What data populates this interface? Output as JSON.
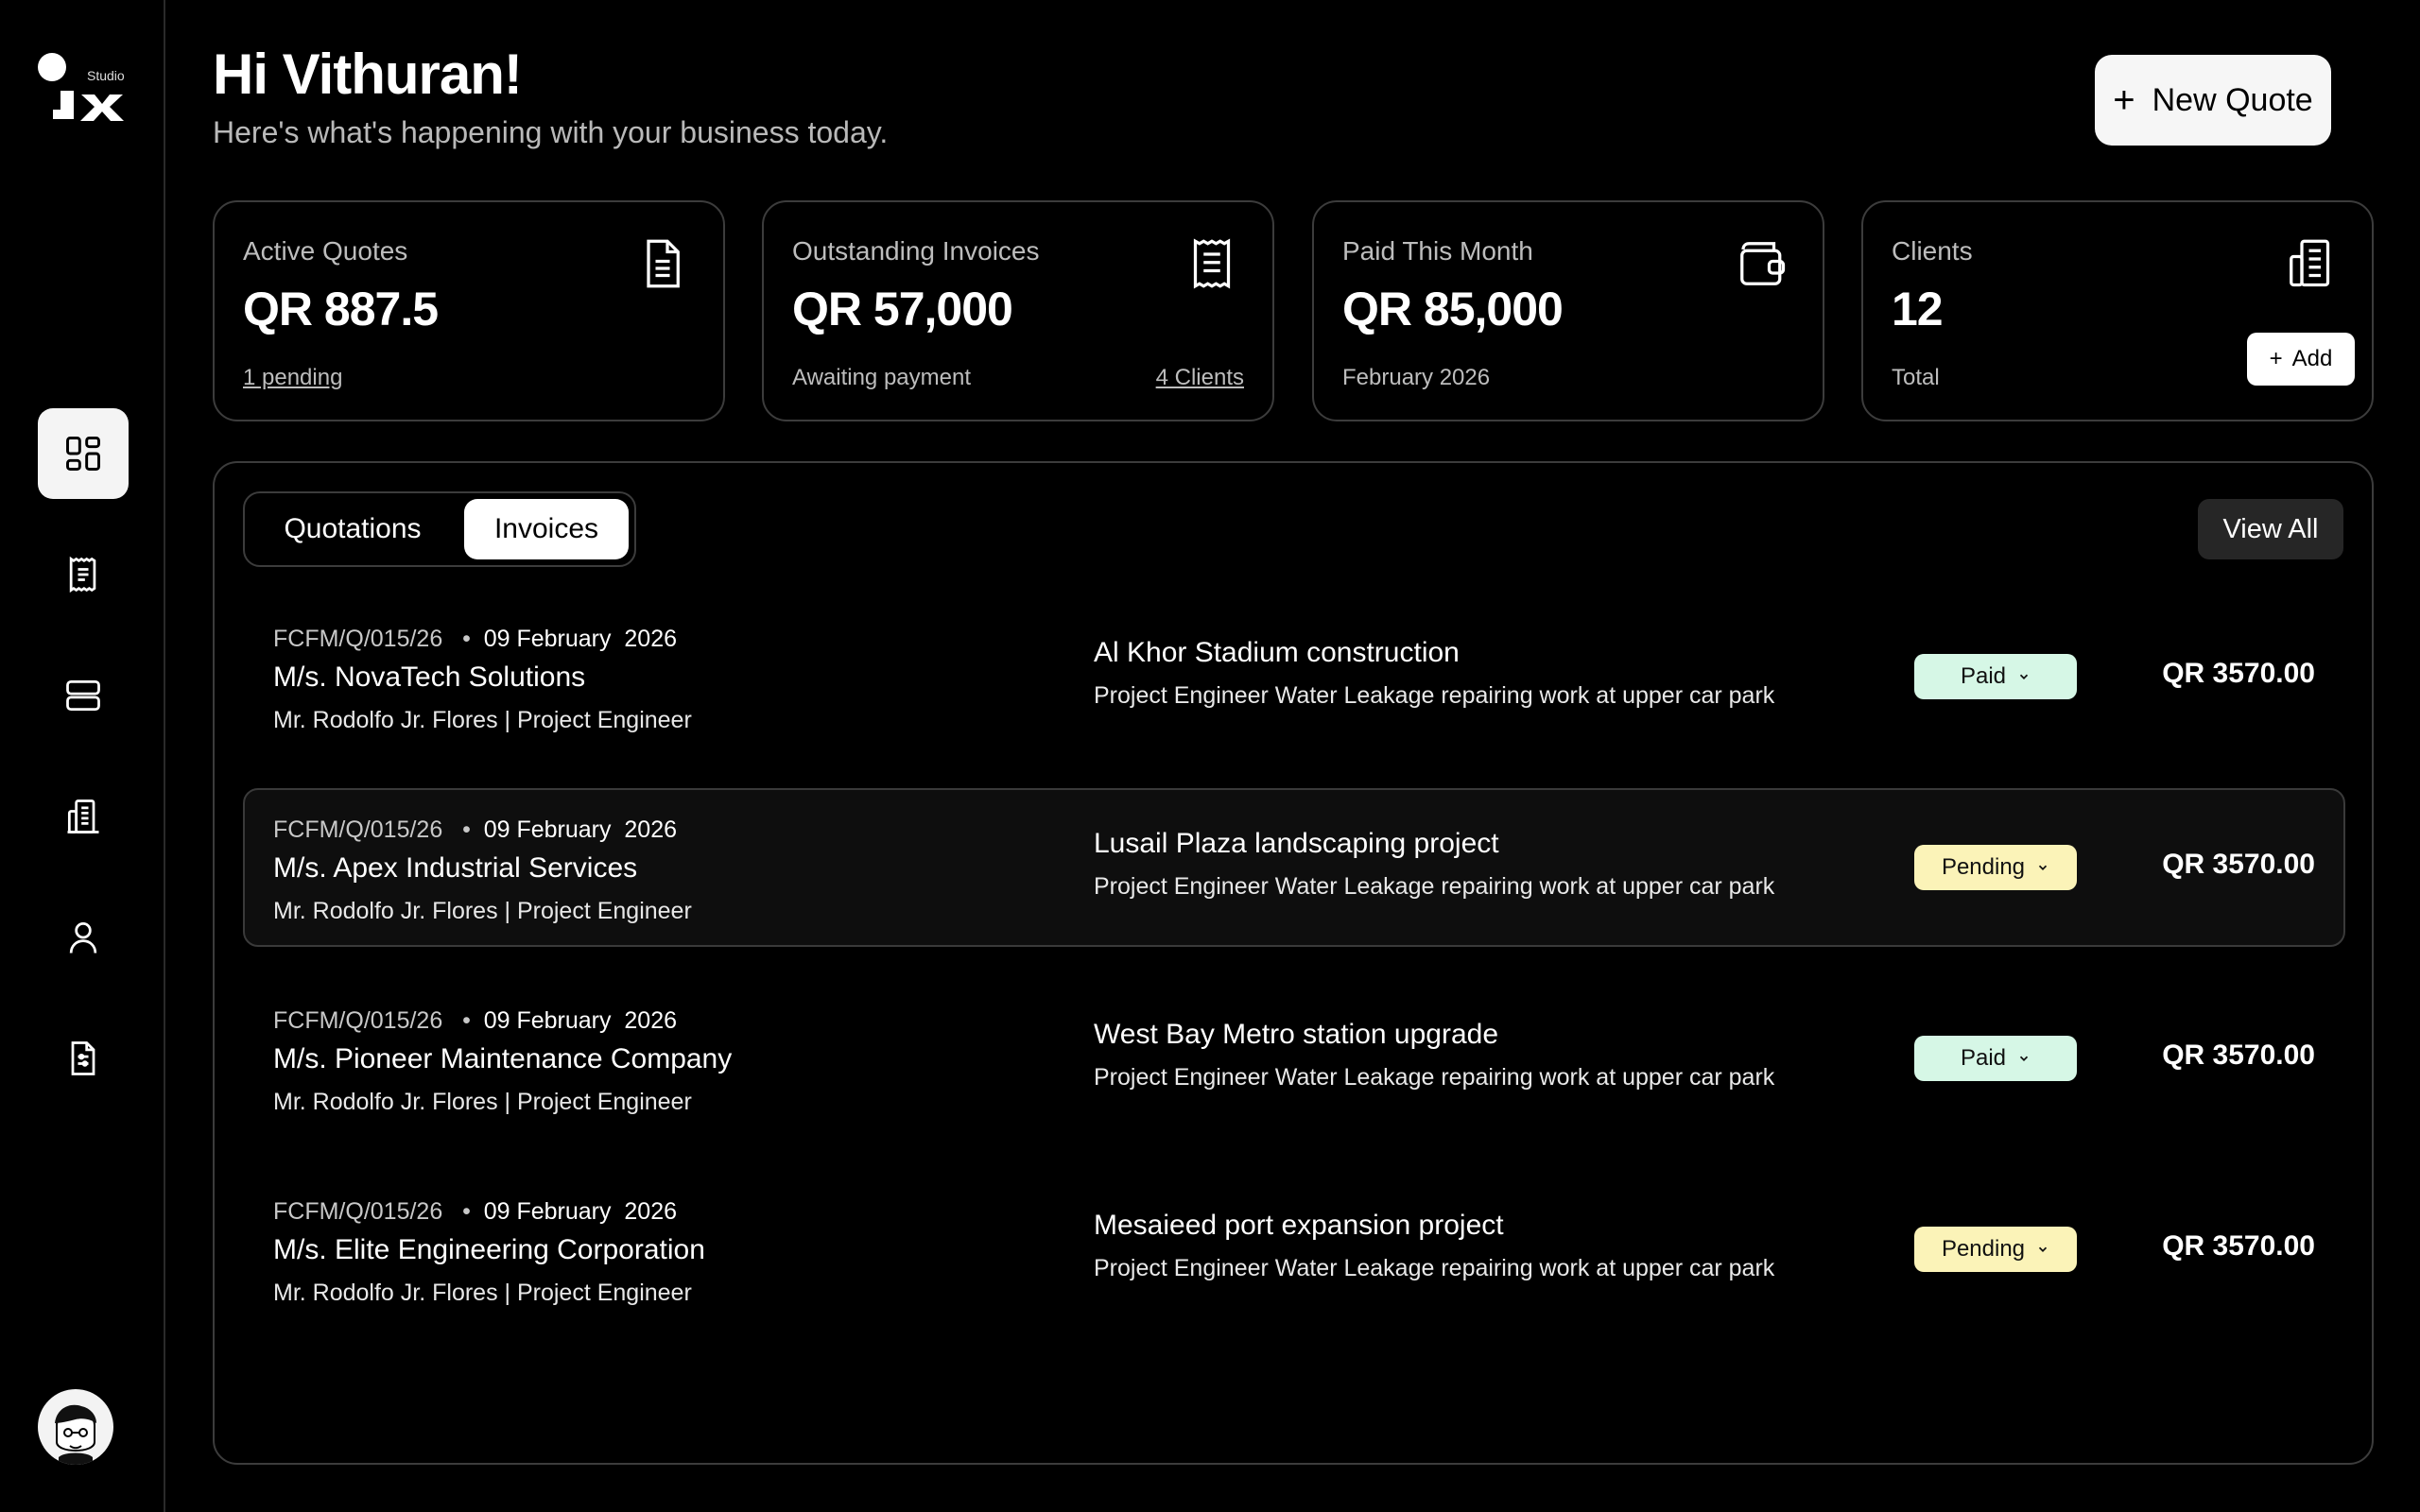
{
  "brand": {
    "logo_text": "Studio"
  },
  "header": {
    "greeting": "Hi Vithuran!",
    "subtitle": "Here's what's happening with your business today.",
    "new_quote_label": "New Quote"
  },
  "sidebar": {
    "items": [
      {
        "name": "dashboard",
        "active": true
      },
      {
        "name": "invoices",
        "active": false
      },
      {
        "name": "services",
        "active": false
      },
      {
        "name": "clients",
        "active": false
      },
      {
        "name": "profile",
        "active": false
      },
      {
        "name": "reports",
        "active": false
      }
    ]
  },
  "stats": {
    "active_quotes": {
      "label": "Active Quotes",
      "value": "QR 887.5",
      "foot": "1 pending"
    },
    "outstanding": {
      "label": "Outstanding Invoices",
      "value": "QR 57,000",
      "foot": "Awaiting payment",
      "foot_right": "4 Clients"
    },
    "paid_month": {
      "label": "Paid This Month",
      "value": "QR 85,000",
      "foot": "February 2026"
    },
    "clients": {
      "label": "Clients",
      "value": "12",
      "foot": "Total",
      "add_label": "Add"
    }
  },
  "panel": {
    "tabs": {
      "quotations": "Quotations",
      "invoices": "Invoices",
      "active": "invoices"
    },
    "view_all": "View All",
    "rows": [
      {
        "ref": "FCFM/Q/015/26",
        "date": "09 February  2026",
        "client": "M/s. NovaTech Solutions",
        "contact": "Mr. Rodolfo Jr. Flores | Project Engineer",
        "project": "Al Khor Stadium construction",
        "desc": "Project Engineer Water Leakage repairing work at upper car park",
        "status": "Paid",
        "amount": "QR 3570.00"
      },
      {
        "ref": "FCFM/Q/015/26",
        "date": "09 February  2026",
        "client": "M/s. Apex Industrial Services",
        "contact": "Mr. Rodolfo Jr. Flores | Project Engineer",
        "project": "Lusail Plaza landscaping project",
        "desc": "Project Engineer Water Leakage repairing work at upper car park",
        "status": "Pending",
        "amount": "QR 3570.00"
      },
      {
        "ref": "FCFM/Q/015/26",
        "date": "09 February  2026",
        "client": "M/s. Pioneer Maintenance Company",
        "contact": "Mr. Rodolfo Jr. Flores | Project Engineer",
        "project": "West Bay Metro station upgrade",
        "desc": "Project Engineer Water Leakage repairing work at upper car park",
        "status": "Paid",
        "amount": "QR 3570.00"
      },
      {
        "ref": "FCFM/Q/015/26",
        "date": "09 February  2026",
        "client": "M/s. Elite Engineering Corporation",
        "contact": "Mr. Rodolfo Jr. Flores | Project Engineer",
        "project": "Mesaieed port expansion project",
        "desc": "Project Engineer Water Leakage repairing work at upper car park",
        "status": "Pending",
        "amount": "QR 3570.00"
      }
    ]
  },
  "colors": {
    "background": "#000000",
    "paid_badge": "#d6f7e6",
    "pending_badge": "#fbf3b8",
    "accent_button": "#f6f6f6"
  },
  "icons": [
    "grid-icon",
    "receipt-icon",
    "server-icon",
    "building-icon",
    "user-icon",
    "file-settings-icon",
    "document-icon",
    "wallet-icon",
    "plus-icon",
    "chevron-down-icon"
  ]
}
